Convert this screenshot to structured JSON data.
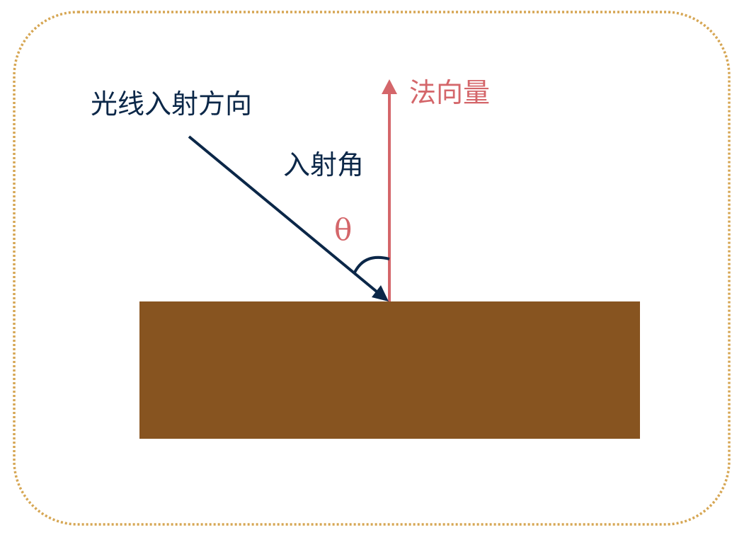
{
  "labels": {
    "light_direction": "光线入射方向",
    "normal": "法向量",
    "incident_angle": "入射角",
    "theta": "θ"
  },
  "colors": {
    "frame_border": "#d6a653",
    "surface": "#875420",
    "light_ray": "#0b2748",
    "normal_vector": "#d4666a",
    "angle_arc": "#0b2748",
    "background": "#ffffff"
  }
}
